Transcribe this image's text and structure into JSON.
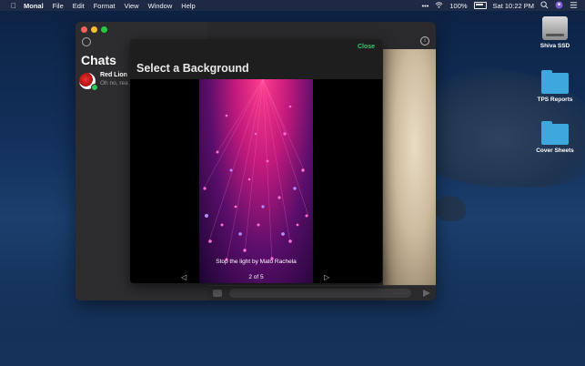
{
  "menubar": {
    "app": "Monal",
    "items": [
      "File",
      "Edit",
      "Format",
      "View",
      "Window",
      "Help"
    ],
    "battery": "100%",
    "clock": "Sat 10:22 PM"
  },
  "desktop": {
    "icons": [
      {
        "label": "Shiva SSD",
        "kind": "drive"
      },
      {
        "label": "TPS Reports",
        "kind": "folder"
      },
      {
        "label": "Cover Sheets",
        "kind": "folder"
      }
    ]
  },
  "sidebar": {
    "title": "Chats",
    "chats": [
      {
        "name": "Red Lion",
        "preview": "Oh no, rea"
      }
    ]
  },
  "modal": {
    "close_label": "Close",
    "title": "Select a Background",
    "caption": "Stop the light by Mato Rachela",
    "counter": "2 of 5",
    "prev_icon": "◁",
    "next_icon": "▷"
  },
  "colors": {
    "accent_green": "#2ecc71",
    "online_green": "#34c759"
  }
}
